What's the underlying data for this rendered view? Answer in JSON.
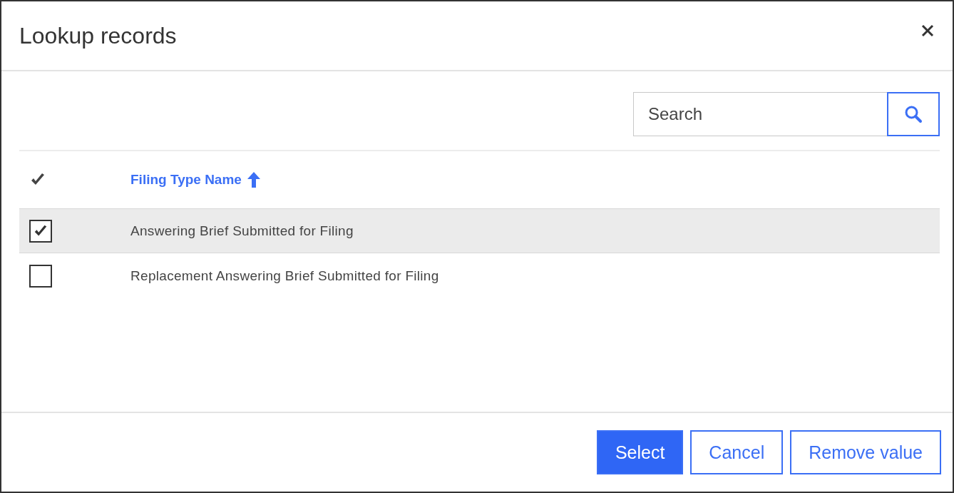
{
  "dialog": {
    "title": "Lookup records"
  },
  "search": {
    "placeholder": "Search"
  },
  "table": {
    "columns": [
      {
        "label": "Filing Type Name",
        "sorted_ascending": true
      }
    ],
    "rows": [
      {
        "name": "Answering Brief Submitted for Filing",
        "selected": true
      },
      {
        "name": "Replacement Answering Brief Submitted for Filing",
        "selected": false
      }
    ]
  },
  "buttons": [
    {
      "label": "Select",
      "kind": "primary"
    },
    {
      "label": "Cancel",
      "kind": "secondary"
    },
    {
      "label": "Remove value",
      "kind": "secondary"
    }
  ]
}
